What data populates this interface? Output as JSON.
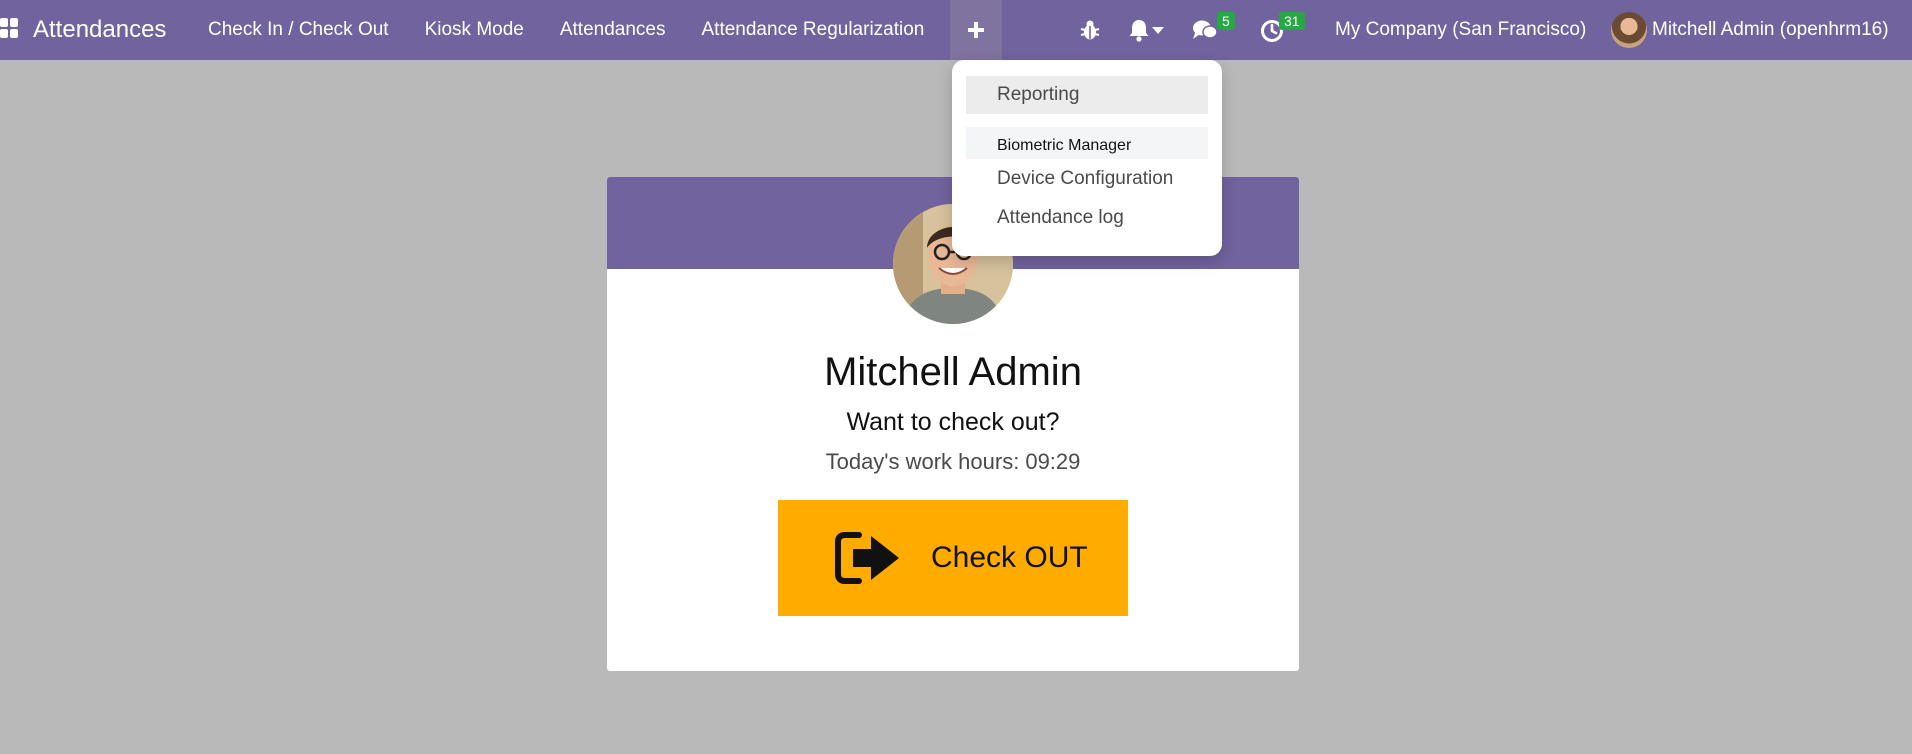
{
  "app": {
    "title": "Attendances"
  },
  "nav": {
    "items": [
      {
        "label": "Check In / Check Out"
      },
      {
        "label": "Kiosk Mode"
      },
      {
        "label": "Attendances"
      },
      {
        "label": "Attendance Regularization"
      }
    ],
    "plus_icon": "plus-icon"
  },
  "systray": {
    "bug_icon": "bug-icon",
    "bell_icon": "bell-icon",
    "messages_badge": "5",
    "activities_badge": "31",
    "company": "My Company (San Francisco)",
    "user": "Mitchell Admin (openhrm16)"
  },
  "dropdown": {
    "reporting": "Reporting",
    "section_header": "Biometric Manager",
    "items": [
      {
        "label": "Device Configuration"
      },
      {
        "label": "Attendance log"
      }
    ]
  },
  "card": {
    "employee_name": "Mitchell Admin",
    "prompt": "Want to check out?",
    "hours_label": "Today's work hours:",
    "hours_value": "09:29",
    "button_label": "Check OUT"
  },
  "colors": {
    "navbar": "#71639e",
    "checkout_button": "#ffab00",
    "badge": "#28a745",
    "background": "#b9b9b9"
  }
}
